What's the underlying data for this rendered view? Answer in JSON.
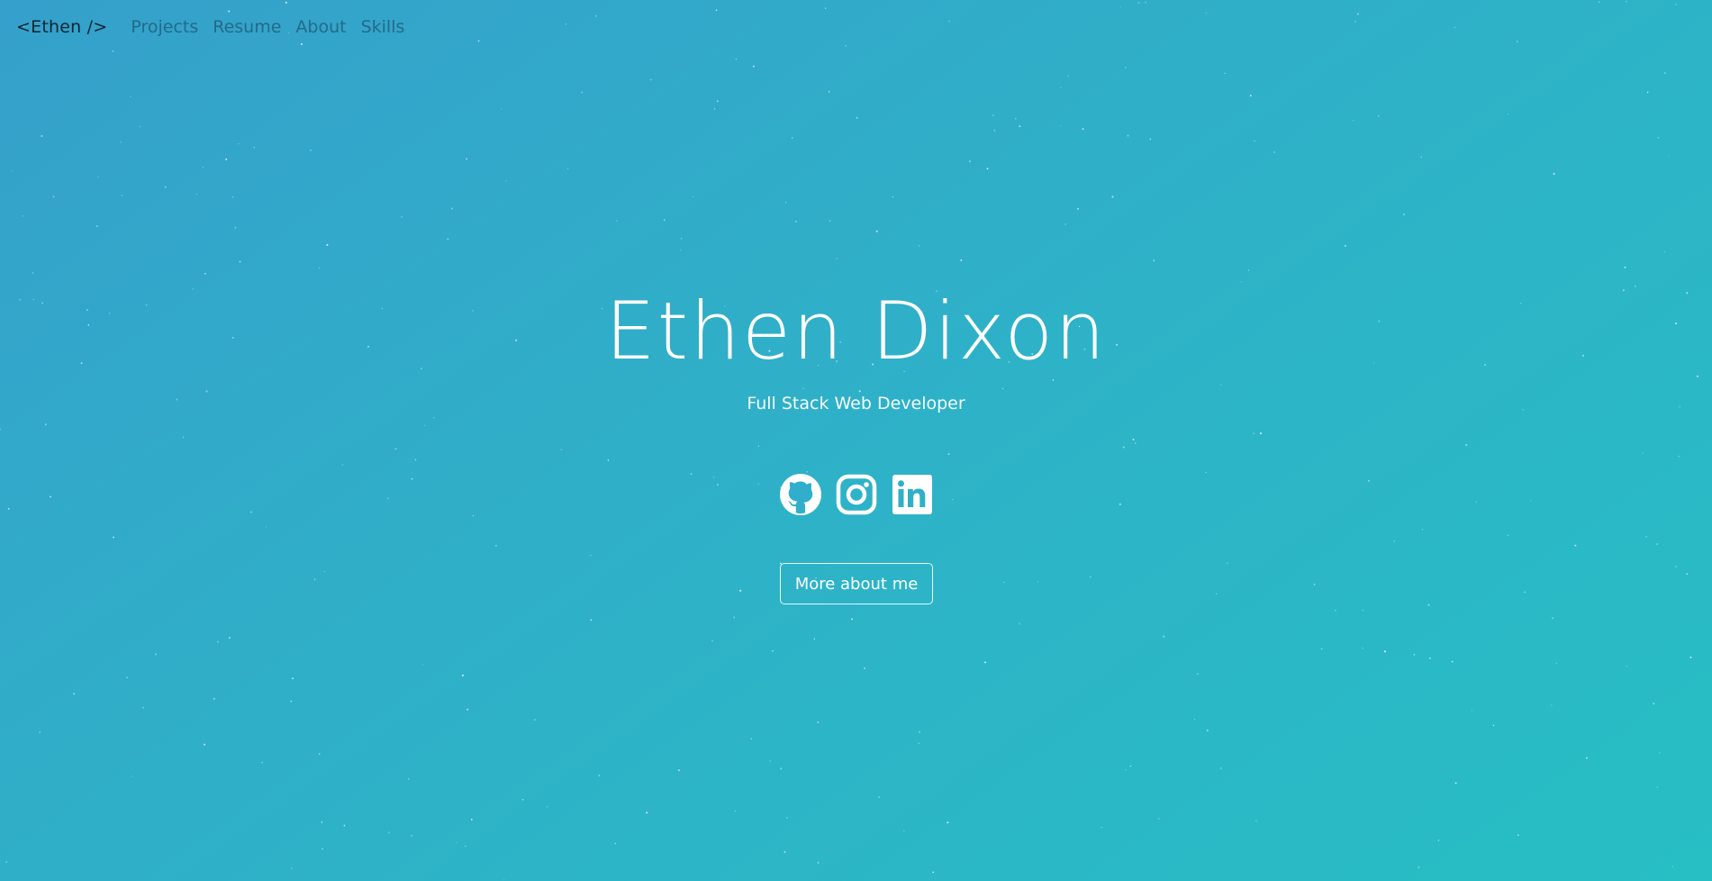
{
  "nav": {
    "brand": "<Ethen />",
    "links": [
      "Projects",
      "Resume",
      "About",
      "Skills"
    ]
  },
  "hero": {
    "name": "Ethen Dixon",
    "subtitle": "Full Stack Web Developer",
    "cta_label": "More about me"
  },
  "socials": [
    {
      "icon": "github-icon"
    },
    {
      "icon": "instagram-icon"
    },
    {
      "icon": "linkedin-icon"
    }
  ],
  "colors": {
    "gradient_start": "#35a0cb",
    "gradient_end": "#27bec4",
    "text": "#ffffff",
    "brand_text": "#0d2530"
  }
}
